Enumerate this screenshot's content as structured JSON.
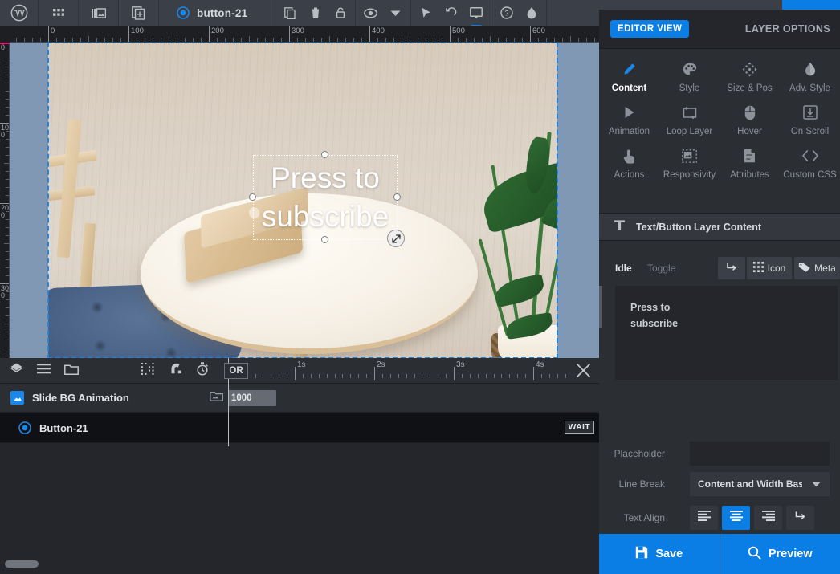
{
  "topbar": {
    "logo": "wordpress-logo",
    "icons": [
      "grid-icon",
      "slides-icon",
      "add-slide-icon"
    ],
    "layer_title": "button-21",
    "layer_status_icon": "record-icon",
    "tools": [
      "copy-icon",
      "trash-icon",
      "lock-icon",
      "visibility-icon",
      "chevron-down-icon",
      "cursor-icon",
      "undo-icon",
      "monitor-icon",
      "help-icon",
      "contrast-icon"
    ]
  },
  "rulers": {
    "horizontal_labels": [
      "0",
      "100",
      "200",
      "300",
      "400",
      "500",
      "600"
    ],
    "vertical_labels": [
      "0",
      "100",
      "200",
      "300"
    ]
  },
  "canvas": {
    "selected_layer_text": "Press to\nsubscribe",
    "resize_handle_icon": "resize-diagonal-icon"
  },
  "timeline": {
    "left_icons": [
      "layers-icon",
      "list-icon",
      "folder-icon"
    ],
    "mid_icons": [
      "grid-snap-icon",
      "magnet-icon",
      "stopwatch-icon",
      "play-icon"
    ],
    "playhead_label": "OR",
    "ruler_labels": [
      "1s",
      "2s",
      "3s",
      "4s"
    ],
    "close_icon": "close-icon",
    "rows": [
      {
        "name": "Slide BG Animation",
        "icon": "image-icon",
        "folder_icon": "folder-icon",
        "clip_label": "1000",
        "badge": ""
      },
      {
        "name": "Button-21",
        "icon": "record-icon",
        "folder_icon": "",
        "clip_label": "",
        "badge": "WAIT"
      }
    ]
  },
  "right_panel": {
    "editor_view_label": "EDITOR VIEW",
    "layer_options_label": "LAYER OPTIONS",
    "tabs": [
      {
        "label": "Content",
        "icon": "pencil-icon",
        "active": true
      },
      {
        "label": "Style",
        "icon": "palette-icon",
        "active": false
      },
      {
        "label": "Size & Pos",
        "icon": "move-icon",
        "active": false
      },
      {
        "label": "Adv. Style",
        "icon": "contrast-icon",
        "active": false
      },
      {
        "label": "Animation",
        "icon": "play-icon",
        "active": false
      },
      {
        "label": "Loop Layer",
        "icon": "loop-icon",
        "active": false
      },
      {
        "label": "Hover",
        "icon": "mouse-icon",
        "active": false
      },
      {
        "label": "On Scroll",
        "icon": "scroll-down-icon",
        "active": false
      },
      {
        "label": "Actions",
        "icon": "tap-icon",
        "active": false
      },
      {
        "label": "Responsivity",
        "icon": "responsive-icon",
        "active": false
      },
      {
        "label": "Attributes",
        "icon": "document-icon",
        "active": false
      },
      {
        "label": "Custom CSS",
        "icon": "code-icon",
        "active": false
      }
    ],
    "section": {
      "icon": "text-T-icon",
      "title": "Text/Button Layer Content"
    },
    "state_tabs": {
      "idle": "Idle",
      "toggle": "Toggle"
    },
    "chips": [
      {
        "label": "",
        "icon": "line-return-icon"
      },
      {
        "label": "Icon",
        "icon": "grid-dots-icon"
      },
      {
        "label": "Meta",
        "icon": "tag-icon"
      }
    ],
    "content_textarea": {
      "value": "Press to\nsubscribe",
      "placeholder": ""
    },
    "fields": [
      {
        "label": "Placeholder",
        "type": "input",
        "value": "",
        "placeholder": ""
      },
      {
        "label": "Line Break",
        "type": "select",
        "value": "Content and Width Based",
        "caret": "chevron-down-icon"
      }
    ],
    "text_align": {
      "label": "Text Align",
      "options": [
        {
          "icon": "align-left-icon",
          "selected": false
        },
        {
          "icon": "align-center-icon",
          "selected": true
        },
        {
          "icon": "align-right-icon",
          "selected": false
        },
        {
          "icon": "line-return-icon",
          "selected": false
        }
      ]
    },
    "footer": [
      {
        "label": "Save",
        "icon": "save-icon"
      },
      {
        "label": "Preview",
        "icon": "search-icon"
      }
    ]
  },
  "colors": {
    "accent": "#0a7ee4",
    "panel_bg": "#2b2e33",
    "dark_bg": "#24262b",
    "canvas_bg": "#8198b5",
    "selection_outline": "#1a86e8"
  }
}
